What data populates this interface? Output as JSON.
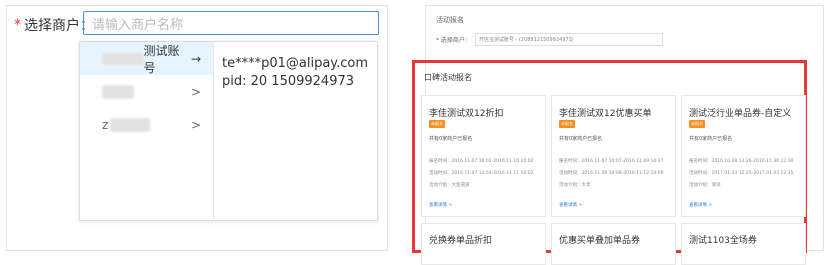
{
  "left": {
    "required_mark": "*",
    "merchant_label": "选择商户：",
    "merchant_placeholder": "请输入商户名称",
    "dropdown": {
      "items": [
        {
          "label": "测试账号",
          "chevron": "→"
        },
        {
          "label": "",
          "chevron": ">"
        },
        {
          "label": "z",
          "chevron": ">"
        }
      ],
      "detail": {
        "email": "te****p01@alipay.com",
        "pid": "pid: 20        1509924973"
      }
    }
  },
  "right": {
    "page_title": "活动报名",
    "merchant_label": "* 选择商户：",
    "merchant_value": "开店宝测试账号 - (2088121509924973)",
    "section_title": "口碑活动报名",
    "cards": [
      {
        "title": "李佳测试双12折扣",
        "badge": "未报名",
        "count": "共有0家商户已报名",
        "signup_time": "报名时间：2016.11.07 16:02-2016.11.10 10:02",
        "activity_time": "活动时间：2016.11.07 13:54-2016.11.11 10:02",
        "intro": "活动介绍：大渔道道",
        "link": "查看详情 >"
      },
      {
        "title": "李佳测试双12优惠买单",
        "badge": "未报名",
        "count": "共有0家商户已报名",
        "signup_time": "报名时间：2016.11.07 10:07-2016.11.09 10:37",
        "activity_time": "活动时间：2016.11.09 10:08-2016.11.12 10:06",
        "intro": "活动介绍：大丰",
        "link": "查看详情 >"
      },
      {
        "title": "测试泛行业单品券-自定义",
        "badge": "未报名",
        "count": "共有0家商户已报名",
        "signup_time": "报名时间：2016.10.28 13:26-2016.11.30 12:30",
        "activity_time": "活动时间：2017.01.03 12:25-2017.01.03 12:35",
        "intro": "活动介绍：测试",
        "link": "查看详情 >"
      }
    ],
    "cards_row2": [
      {
        "title": "兑换券单品折扣"
      },
      {
        "title": "优惠买单叠加单品券"
      },
      {
        "title": "测试1103全场券"
      }
    ]
  }
}
